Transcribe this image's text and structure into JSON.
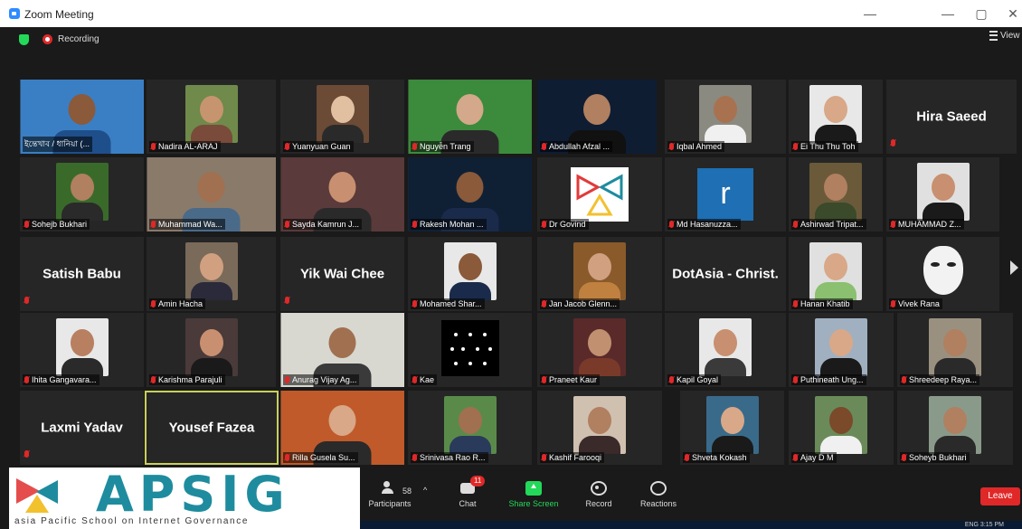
{
  "window": {
    "title": "Zoom Meeting",
    "min_label": "—",
    "max_label": "▢",
    "close_label": "✕",
    "aux_label": "—"
  },
  "topbar": {
    "recording": "Recording",
    "view": "View"
  },
  "colors": {
    "mute": "#e02828",
    "speaker_border": "#c8d05a",
    "share": "#23d959",
    "leave": "#e02828"
  },
  "tiles": [
    {
      "name": "ইন্তেখাব / ধানিয়া (...",
      "kind": "photo",
      "bg": "#3a7fc4",
      "skin": "#8a5a3a",
      "shirt": "#1f4f8a",
      "mic": false
    },
    {
      "name": "Nadira AL-ARAJ",
      "kind": "photo",
      "bg": "#6f8a4a",
      "skin": "#c79470",
      "shirt": "#7a4a3a",
      "mic": true
    },
    {
      "name": "Yuanyuan Guan",
      "kind": "photo",
      "bg": "#6b4a36",
      "skin": "#e0c0a0",
      "shirt": "#2a2a2a",
      "mic": true
    },
    {
      "name": "Nguyễn Trang",
      "kind": "photo",
      "bg": "#3c8a3c",
      "skin": "#d4a88a",
      "shirt": "#2a2a2a",
      "mic": true
    },
    {
      "name": "Abdullah Afzal ...",
      "kind": "photo",
      "bg": "#0f1d33",
      "skin": "#b08060",
      "shirt": "#111111",
      "mic": true
    },
    {
      "name": "Iqbal Ahmed",
      "kind": "photo",
      "bg": "#8a8a80",
      "skin": "#a87250",
      "shirt": "#f0f0f0",
      "mic": true
    },
    {
      "name": "Ei Thu Thu Toh",
      "kind": "photo",
      "bg": "#e8e8e8",
      "skin": "#d8a888",
      "shirt": "#1a1a1a",
      "mic": true
    },
    {
      "name": "Hira Saeed",
      "kind": "text",
      "mic": true
    },
    {
      "name": "Sohejb Bukhari",
      "kind": "photo",
      "bg": "#3a6a2a",
      "skin": "#b08060",
      "shirt": "#2a2a2a",
      "mic": true
    },
    {
      "name": "Muhammad Wa...",
      "kind": "photo",
      "bg": "#8a7a6a",
      "skin": "#a07050",
      "shirt": "#4a6a8a",
      "mic": true
    },
    {
      "name": "Sayda Kamrun J...",
      "kind": "photo",
      "bg": "#5a3a3a",
      "skin": "#c89070",
      "shirt": "#2a2a2a",
      "mic": true
    },
    {
      "name": "Rakesh Mohan ...",
      "kind": "photo",
      "bg": "#0f2035",
      "skin": "#8a5a3a",
      "shirt": "#1a2a4a",
      "mic": true
    },
    {
      "name": "Dr Govind",
      "kind": "trilogo",
      "mic": true
    },
    {
      "name": "Md Hasanuzza...",
      "kind": "rlogo",
      "mic": true
    },
    {
      "name": "Ashirwad Tripat...",
      "kind": "photo",
      "bg": "#6a5a3a",
      "skin": "#b08060",
      "shirt": "#3a4a2a",
      "mic": true
    },
    {
      "name": "MUHAMMAD Z...",
      "kind": "photo",
      "bg": "#e0e0e0",
      "skin": "#c89070",
      "shirt": "#1a1a1a",
      "mic": true
    },
    {
      "name": "Satish Babu",
      "kind": "text",
      "mic": true
    },
    {
      "name": "Amin Hacha",
      "kind": "photo",
      "bg": "#7a6a5a",
      "skin": "#d0a080",
      "shirt": "#2a2a3a",
      "mic": true
    },
    {
      "name": "Yik Wai Chee",
      "kind": "text",
      "mic": true
    },
    {
      "name": "Mohamed Shar...",
      "kind": "photo",
      "bg": "#e8e8e8",
      "skin": "#8a5a3a",
      "shirt": "#1a2a4a",
      "mic": true
    },
    {
      "name": "Jan Jacob Glenn...",
      "kind": "photo",
      "bg": "#8a5a2a",
      "skin": "#d0a080",
      "shirt": "#c08040",
      "mic": true
    },
    {
      "name": "DotAsia - Christ.",
      "kind": "text",
      "mic": false
    },
    {
      "name": "Hanan Khatib",
      "kind": "photo",
      "bg": "#e0e0e0",
      "skin": "#d8a888",
      "shirt": "#8ac070",
      "mic": true
    },
    {
      "name": "Vivek Rana",
      "kind": "mask",
      "mic": true
    },
    {
      "name": "Ihita Gangavara...",
      "kind": "photo",
      "bg": "#e8e8e8",
      "skin": "#b88060",
      "shirt": "#2a2a2a",
      "mic": true
    },
    {
      "name": "Karishma Parajuli",
      "kind": "photo",
      "bg": "#4a3a3a",
      "skin": "#c89070",
      "shirt": "#1a1a1a",
      "mic": true
    },
    {
      "name": "Anurag Vijay Ag...",
      "kind": "photo",
      "bg": "#d8d8d0",
      "skin": "#a07050",
      "shirt": "#3a3a3a",
      "mic": true
    },
    {
      "name": "Kae",
      "kind": "dots",
      "mic": true
    },
    {
      "name": "Praneet Kaur",
      "kind": "photo",
      "bg": "#5a2a2a",
      "skin": "#c09070",
      "shirt": "#7a3a2a",
      "mic": true
    },
    {
      "name": "Kapil Goyal",
      "kind": "photo",
      "bg": "#e8e8e8",
      "skin": "#c89070",
      "shirt": "#3a3a3a",
      "mic": true
    },
    {
      "name": "Puthineath Ung...",
      "kind": "photo",
      "bg": "#a0b0c0",
      "skin": "#d8a888",
      "shirt": "#1a1a1a",
      "mic": true
    },
    {
      "name": "Shreedeep Raya...",
      "kind": "photo",
      "bg": "#9a9080",
      "skin": "#b08060",
      "shirt": "#2a2a2a",
      "mic": true
    },
    {
      "name": "Laxmi Yadav",
      "kind": "text",
      "mic": true
    },
    {
      "name": "Yousef Fazea",
      "kind": "text",
      "mic": false
    },
    {
      "name": "Rilla Gusela Su...",
      "kind": "photo",
      "bg": "#c05a2a",
      "skin": "#d8a888",
      "shirt": "#2a2a2a",
      "mic": true
    },
    {
      "name": "Srinivasa Rao R...",
      "kind": "photo",
      "bg": "#5a8a4a",
      "skin": "#a07050",
      "shirt": "#2a3a5a",
      "mic": true
    },
    {
      "name": "Kashif Farooqi",
      "kind": "photo",
      "bg": "#d0c0b0",
      "skin": "#b08060",
      "shirt": "#3a2a2a",
      "mic": true
    },
    {
      "name": "Shveta Kokash",
      "kind": "photo",
      "bg": "#3a6a8a",
      "skin": "#d8a888",
      "shirt": "#1a1a1a",
      "mic": true
    },
    {
      "name": "Ajay D M",
      "kind": "photo",
      "bg": "#6a8a5a",
      "skin": "#7a4a2a",
      "shirt": "#f0f0f0",
      "mic": true
    },
    {
      "name": "Soheyb Bukhari",
      "kind": "photo",
      "bg": "#8a9a8a",
      "skin": "#b08060",
      "shirt": "#2a2a2a",
      "mic": true
    }
  ],
  "toolbar": {
    "participants_label": "Participants",
    "participants_count": "58",
    "chat_label": "Chat",
    "chat_badge": "11",
    "share_label": "Share Screen",
    "record_label": "Record",
    "reactions_label": "Reactions",
    "leave_label": "Leave"
  },
  "logo": {
    "word": "APSIG",
    "tagline": "asia Pacific School on Internet Governance"
  },
  "taskbar": {
    "tray": "ENG 3:15 PM"
  }
}
